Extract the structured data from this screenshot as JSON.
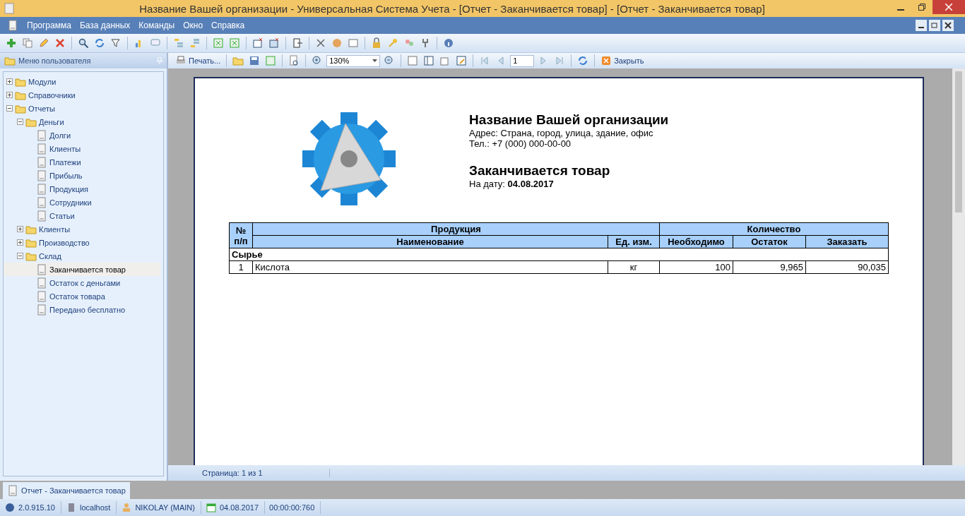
{
  "window": {
    "title": "Название Вашей организации - Универсальная Система Учета - [Отчет - Заканчивается товар] - [Отчет - Заканчивается товар]"
  },
  "menu": [
    "Программа",
    "База данных",
    "Команды",
    "Окно",
    "Справка"
  ],
  "sidebar": {
    "title": "Меню пользователя",
    "items": [
      {
        "label": "Модули",
        "kind": "folder",
        "expanded": false,
        "selected": false
      },
      {
        "label": "Справочники",
        "kind": "folder",
        "expanded": false,
        "selected": false
      },
      {
        "label": "Отчеты",
        "kind": "folder",
        "expanded": true,
        "selected": false,
        "children": [
          {
            "label": "Деньги",
            "kind": "folder",
            "expanded": true,
            "selected": false,
            "children": [
              {
                "label": "Долги",
                "kind": "report",
                "selected": false
              },
              {
                "label": "Клиенты",
                "kind": "report",
                "selected": false
              },
              {
                "label": "Платежи",
                "kind": "report",
                "selected": false
              },
              {
                "label": "Прибыль",
                "kind": "report",
                "selected": false
              },
              {
                "label": "Продукция",
                "kind": "report",
                "selected": false
              },
              {
                "label": "Сотрудники",
                "kind": "report",
                "selected": false
              },
              {
                "label": "Статьи",
                "kind": "report",
                "selected": false
              }
            ]
          },
          {
            "label": "Клиенты",
            "kind": "folder",
            "expanded": false,
            "selected": false
          },
          {
            "label": "Производство",
            "kind": "folder",
            "expanded": false,
            "selected": false
          },
          {
            "label": "Склад",
            "kind": "folder",
            "expanded": true,
            "selected": false,
            "children": [
              {
                "label": "Заканчивается товар",
                "kind": "report",
                "selected": true
              },
              {
                "label": "Остаток с деньгами",
                "kind": "report",
                "selected": false
              },
              {
                "label": "Остаток товара",
                "kind": "report",
                "selected": false
              },
              {
                "label": "Передано бесплатно",
                "kind": "report",
                "selected": false
              }
            ]
          }
        ]
      }
    ]
  },
  "report_toolbar": {
    "print": "Печать...",
    "zoom": "130%",
    "page": "1",
    "close": "Закрыть"
  },
  "report": {
    "org_name": "Название Вашей организации",
    "address": "Адрес: Страна, город, улица, здание, офис",
    "phone": "Тел.: +7 (000) 000-00-00",
    "title": "Заканчивается товар",
    "date": "На дату: **04.08.2017**",
    "table": {
      "num_header": "№ п/п",
      "group_product": "Продукция",
      "group_quantity": "Количество",
      "columns": [
        "Наименование",
        "Ед. изм.",
        "Необходимо",
        "Остаток",
        "Заказать"
      ],
      "sections": [
        {
          "name": "Сырье",
          "rows": [
            [
              "1",
              "Кислота",
              "кг",
              "100",
              "9,965",
              "90,035"
            ]
          ]
        }
      ]
    }
  },
  "page_status": "Страница: 1 из 1",
  "document_tabs": [
    {
      "label": "Отчет - Заканчивается товар",
      "selected": true
    }
  ],
  "status_bar": [
    "2.0.915.10",
    "localhost",
    "NIKOLAY (MAIN)",
    "04.08.2017",
    "00:00:00:760"
  ]
}
